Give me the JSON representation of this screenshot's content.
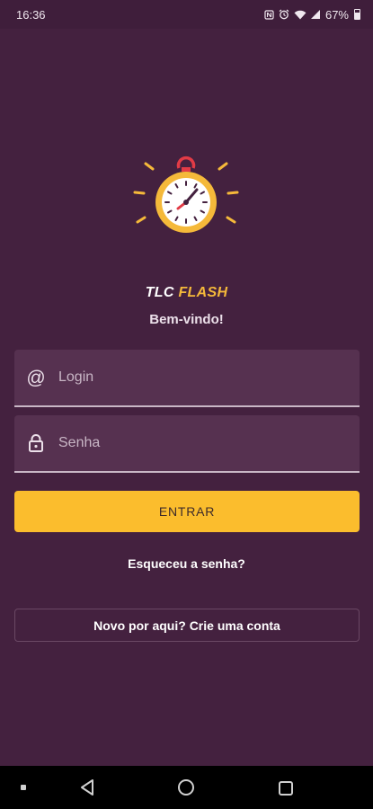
{
  "status_bar": {
    "time": "16:36",
    "battery_percent": "67%",
    "icons": [
      "nfc-icon",
      "alarm-icon",
      "wifi-icon",
      "signal-icon",
      "battery-icon"
    ]
  },
  "app": {
    "title_part1": "TLC",
    "title_part2": "FLASH",
    "welcome": "Bem-vindo!",
    "logo": "stopwatch-icon"
  },
  "form": {
    "login_placeholder": "Login",
    "password_placeholder": "Senha",
    "login_value": "",
    "password_value": ""
  },
  "actions": {
    "submit_label": "ENTRAR",
    "forgot_label": "Esqueceu a senha?",
    "signup_label": "Novo por aqui? Crie uma conta"
  },
  "colors": {
    "background": "#44213f",
    "accent": "#fbbd2d",
    "input_background": "#563150"
  },
  "nav_bar": {
    "buttons": [
      "menu-dot-icon",
      "back-icon",
      "home-icon",
      "recents-icon"
    ]
  }
}
